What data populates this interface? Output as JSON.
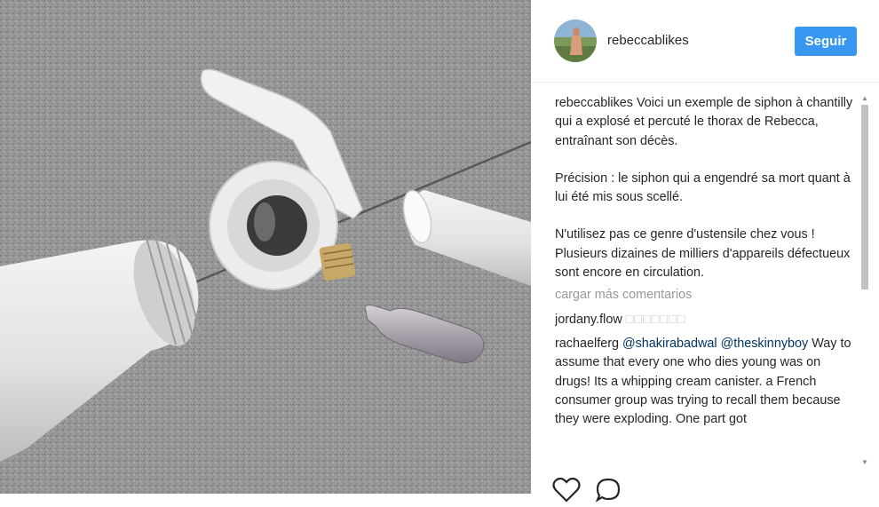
{
  "post": {
    "username": "rebeccablikes",
    "follow_label": "Seguir",
    "caption_user": "rebeccablikes",
    "caption_p1": "Voici un exemple de siphon à chantilly qui a explosé et percuté le thorax de Rebecca, entraînant son décès.",
    "caption_p2": "Précision : le siphon qui a engendré sa mort quant à lui été mis sous scellé.",
    "caption_p3": "N'utilisez pas ce genre d'ustensile chez vous ! Plusieurs dizaines de milliers d'appareils défectueux sont encore en circulation.",
    "load_more": "cargar más comentarios"
  },
  "comments": [
    {
      "user": "jordany.flow",
      "text": "□□□□□□□"
    },
    {
      "user": "rachaelferg",
      "mention1": "@shakirabadwal",
      "mention2": "@theskinnyboy",
      "text": "Way to assume that every one who dies young was on drugs! Its a whipping cream canister. a French consumer group was trying to recall them because they were exploding. One part got"
    }
  ],
  "icons": {
    "like": "heart-icon",
    "comment": "comment-icon"
  },
  "colors": {
    "follow_button": "#3897f0",
    "mention": "#003569",
    "muted": "#999999"
  }
}
